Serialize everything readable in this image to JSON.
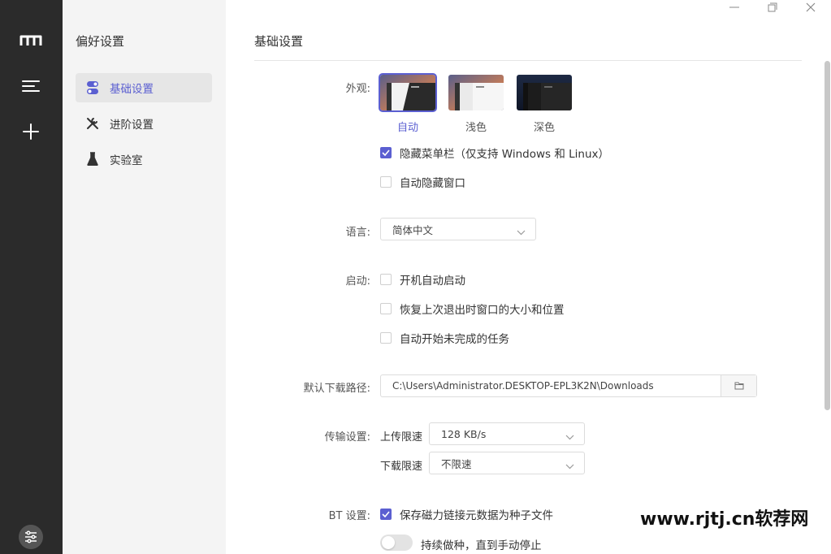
{
  "sidebar": {
    "title": "偏好设置",
    "items": [
      {
        "label": "基础设置",
        "icon": "toggle-icon",
        "active": true
      },
      {
        "label": "进阶设置",
        "icon": "tools-icon",
        "active": false
      },
      {
        "label": "实验室",
        "icon": "flask-icon",
        "active": false
      }
    ]
  },
  "main": {
    "title": "基础设置",
    "appearance": {
      "label": "外观:",
      "themes": [
        {
          "label": "自动",
          "selected": true
        },
        {
          "label": "浅色",
          "selected": false
        },
        {
          "label": "深色",
          "selected": false
        }
      ],
      "options": [
        {
          "label": "隐藏菜单栏（仅支持 Windows 和 Linux）",
          "checked": true
        },
        {
          "label": "自动隐藏窗口",
          "checked": false
        }
      ]
    },
    "language": {
      "label": "语言:",
      "value": "简体中文"
    },
    "startup": {
      "label": "启动:",
      "options": [
        {
          "label": "开机自动启动",
          "checked": false
        },
        {
          "label": "恢复上次退出时窗口的大小和位置",
          "checked": false
        },
        {
          "label": "自动开始未完成的任务",
          "checked": false
        }
      ]
    },
    "download_path": {
      "label": "默认下载路径:",
      "value": "C:\\Users\\Administrator.DESKTOP-EPL3K2N\\Downloads"
    },
    "transfer": {
      "label": "传输设置:",
      "upload_label": "上传限速",
      "upload_value": "128 KB/s",
      "download_label": "下载限速",
      "download_value": "不限速"
    },
    "bt": {
      "label": "BT 设置:",
      "save_magnet": {
        "label": "保存磁力链接元数据为种子文件",
        "checked": true
      },
      "keep_seeding": {
        "label": "持续做种，直到手动停止",
        "on": false
      }
    }
  },
  "watermark": "www.rjtj.cn软荐网",
  "colors": {
    "accent": "#5b5fd1",
    "rail": "#2b2b2b",
    "sidebar": "#f4f4f4"
  }
}
